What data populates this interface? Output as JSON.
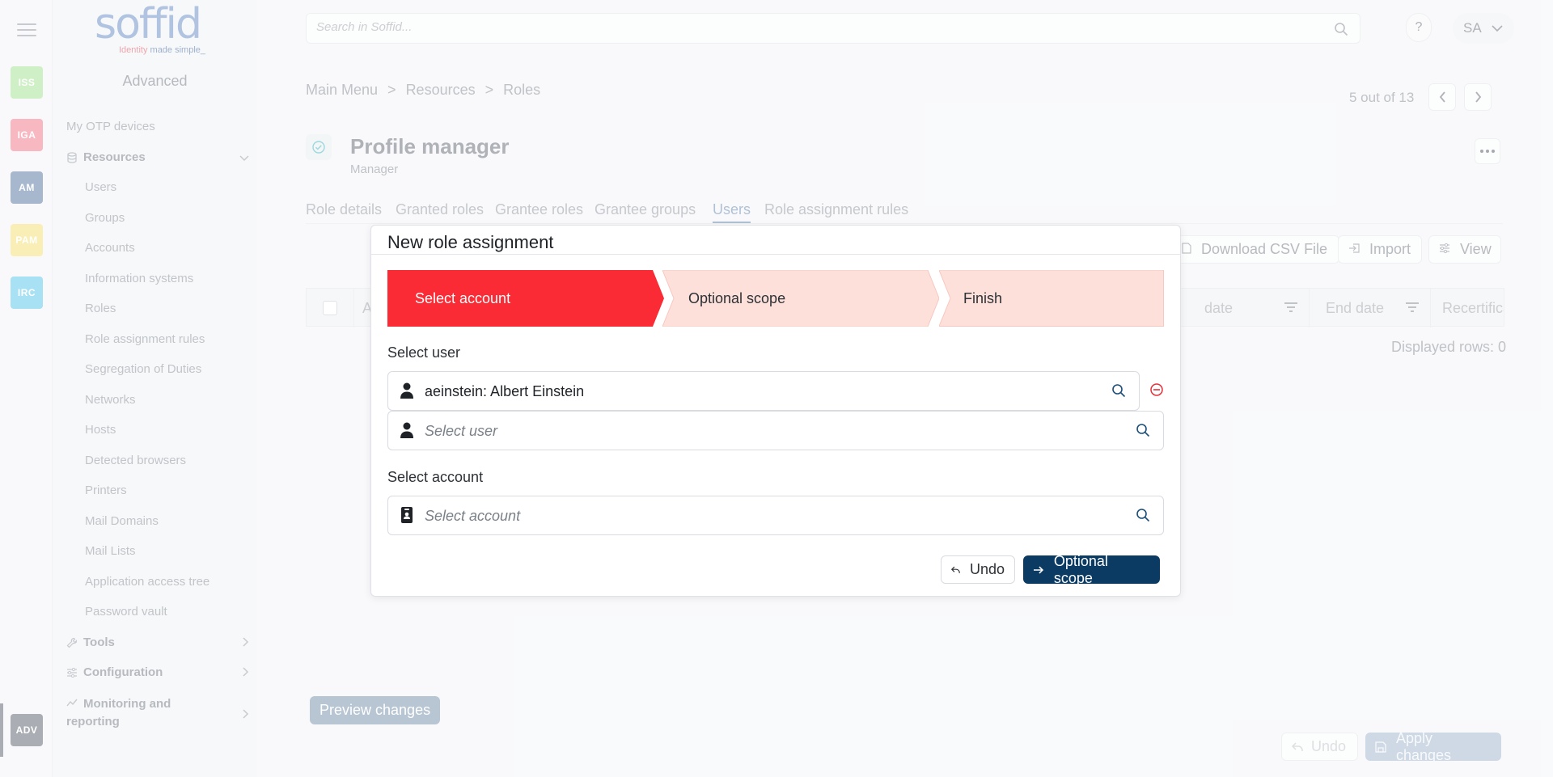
{
  "rail": {
    "badges": [
      {
        "label": "ISS",
        "color": "#a8e39a"
      },
      {
        "label": "IGA",
        "color": "#f07f8f"
      },
      {
        "label": "AM",
        "color": "#5f7fa6"
      },
      {
        "label": "PAM",
        "color": "#f5e27a"
      },
      {
        "label": "IRC",
        "color": "#5fc9ea"
      },
      {
        "label": "ADV",
        "color": "#646b75"
      }
    ]
  },
  "sidebar": {
    "logo": "soffid",
    "logo_sub_a": "Identity",
    "logo_sub_b": "made simple_",
    "title": "Advanced",
    "items": {
      "otp": "My OTP devices",
      "resources": "Resources",
      "users": "Users",
      "groups": "Groups",
      "accounts": "Accounts",
      "information_systems": "Information systems",
      "roles": "Roles",
      "role_assignment_rules": "Role assignment rules",
      "segregation": "Segregation of Duties",
      "networks": "Networks",
      "hosts": "Hosts",
      "detected_browsers": "Detected browsers",
      "printers": "Printers",
      "mail_domains": "Mail Domains",
      "mail_lists": "Mail Lists",
      "application_access_tree": "Application access tree",
      "password_vault": "Password vault",
      "tools": "Tools",
      "configuration": "Configuration",
      "monitoring_1": "Monitoring and",
      "monitoring_2": "reporting"
    }
  },
  "header": {
    "search_placeholder": "Search in Soffid...",
    "help": "?",
    "avatar": "SA"
  },
  "breadcrumb": {
    "a": "Main Menu",
    "b": "Resources",
    "c": "Roles",
    "sep": ">"
  },
  "pager": {
    "text": "5 out of 13"
  },
  "role": {
    "title": "Profile manager",
    "subtitle": "Manager"
  },
  "tabs": {
    "role_details": "Role details",
    "granted_roles": "Granted roles",
    "grantee_roles": "Grantee roles",
    "grantee_groups": "Grantee groups",
    "users": "Users",
    "role_assignment_rules": "Role assignment rules"
  },
  "toolbar": {
    "download": "Download CSV File",
    "import": "Import",
    "view": "View"
  },
  "grid": {
    "col_a": "A",
    "col_start": "date",
    "col_end": "End date",
    "col_recert": "Recertification",
    "displayed": "Displayed rows: 0"
  },
  "footer": {
    "preview": "Preview changes",
    "undo": "Undo",
    "apply": "Apply changes"
  },
  "modal": {
    "title": "New role assignment",
    "steps": [
      "Select account",
      "Optional scope",
      "Finish"
    ],
    "select_user_label": "Select user",
    "selected_user": "aeinstein: Albert Einstein",
    "select_user_placeholder": "Select user",
    "select_account_label": "Select account",
    "select_account_placeholder": "Select account",
    "undo": "Undo",
    "next": "Optional scope"
  },
  "colors": {
    "step_active": "#fa2b35",
    "step_inactive": "#fde0da",
    "primary": "#0b3a63"
  }
}
